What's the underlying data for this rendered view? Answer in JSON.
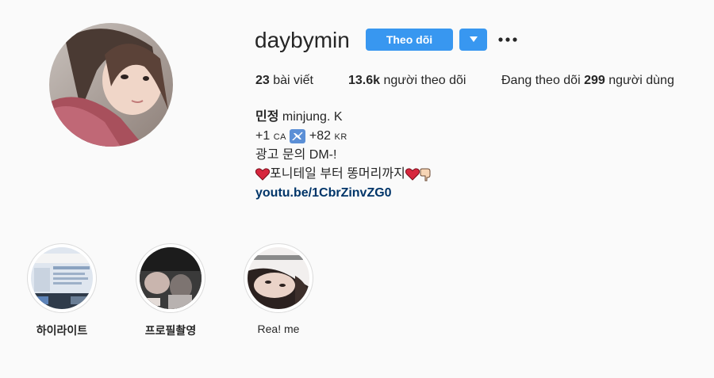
{
  "profile": {
    "username": "daybymin",
    "follow_label": "Theo dõi",
    "stats": {
      "posts_count": "23",
      "posts_label": "bài viết",
      "followers_count": "13.6k",
      "followers_label": "người theo dõi",
      "following_prefix": "Đang theo dõi",
      "following_count": "299",
      "following_suffix": "người dùng"
    },
    "bio": {
      "name": "민정",
      "name_suffix": "minjung. K",
      "line1_left": "+1",
      "line1_left_code": "CA",
      "line1_right": "+82",
      "line1_right_code": "KR",
      "line2": "광고 문의 DM-!",
      "line3": "포니테일 부터 똥머리까지",
      "link": "youtu.be/1CbrZinvZG0"
    }
  },
  "highlights": [
    {
      "label": "하이라이트"
    },
    {
      "label": "프로필촬영"
    },
    {
      "label": "Rea! me"
    }
  ],
  "colors": {
    "accent": "#3897f0",
    "link": "#003569",
    "background": "#fafafa",
    "text": "#262626"
  },
  "icons": [
    "dropdown-arrow-icon",
    "more-options-icon",
    "airplane-icon",
    "heart-icon",
    "pointing-down-icon"
  ]
}
